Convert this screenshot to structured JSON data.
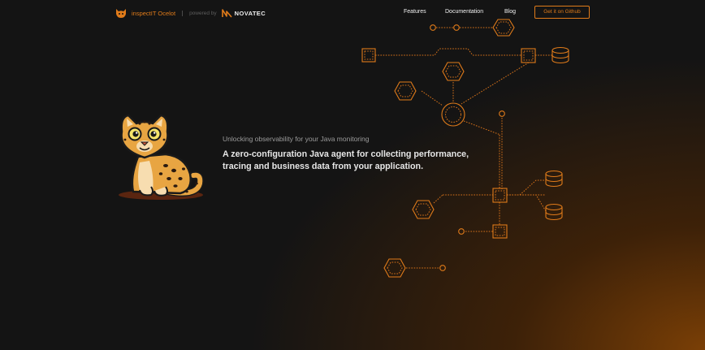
{
  "header": {
    "brand_name": "inspectIT Ocelot",
    "powered_by": "powered by",
    "partner_name": "NOVATEC",
    "nav": {
      "features": "Features",
      "documentation": "Documentation",
      "blog": "Blog",
      "github": "Get it on Github"
    }
  },
  "hero": {
    "tagline": "Unlocking observability for your Java monitoring",
    "headline": "A zero-configuration Java agent for collecting performance, tracing and business data from your application."
  },
  "theme": {
    "accent": "#e07b1a",
    "background": "#141414"
  },
  "icons": {
    "brand": "ocelot-head-icon",
    "partner": "novatec-logo-icon",
    "mascot": "ocelot-mascot-illustration",
    "diagram_nodes": [
      "square-node-icon",
      "hexagon-node-icon",
      "circle-node-icon",
      "database-icon"
    ]
  }
}
